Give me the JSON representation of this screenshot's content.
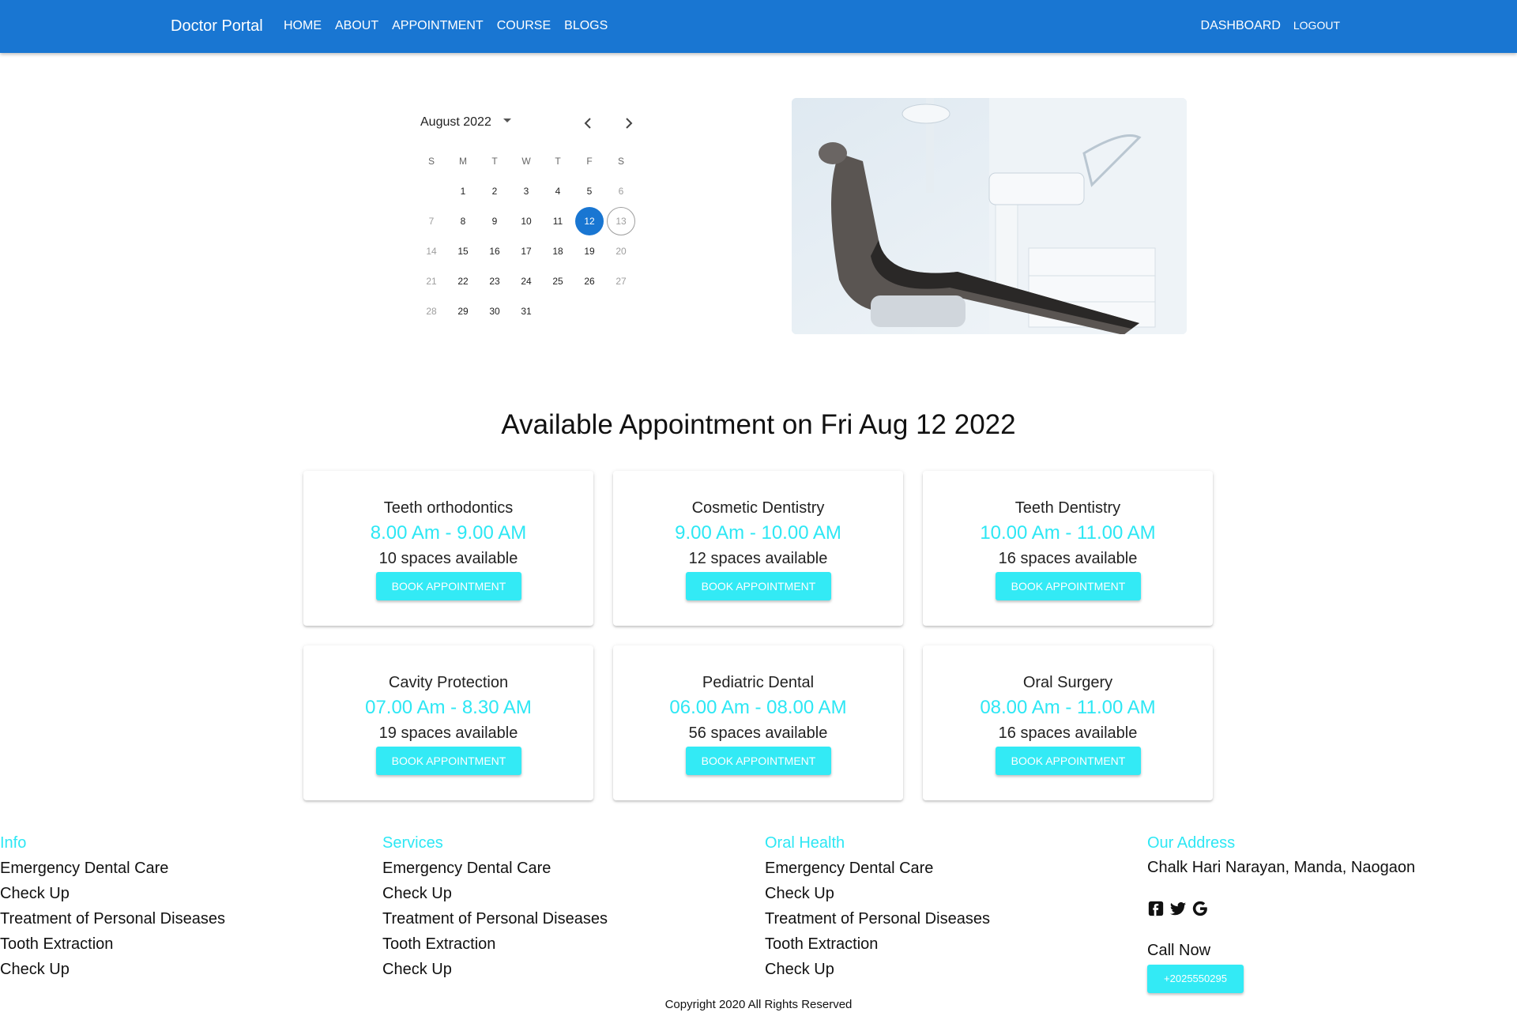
{
  "nav": {
    "brand": "Doctor Portal",
    "links": [
      "HOME",
      "ABOUT",
      "APPOINTMENT",
      "COURSE",
      "BLOGS"
    ],
    "dashboard": "DASHBOARD",
    "logout": "LOGOUT"
  },
  "calendar": {
    "month_label": "August 2022",
    "weekdays": [
      "S",
      "M",
      "T",
      "W",
      "T",
      "F",
      "S"
    ],
    "selected_day": 12,
    "today_day": 13,
    "leading_blanks": 1,
    "days": [
      {
        "d": "1",
        "muted": false
      },
      {
        "d": "2",
        "muted": false
      },
      {
        "d": "3",
        "muted": false
      },
      {
        "d": "4",
        "muted": false
      },
      {
        "d": "5",
        "muted": false
      },
      {
        "d": "6",
        "muted": true
      },
      {
        "d": "7",
        "muted": true
      },
      {
        "d": "8",
        "muted": false
      },
      {
        "d": "9",
        "muted": false
      },
      {
        "d": "10",
        "muted": false
      },
      {
        "d": "11",
        "muted": false
      },
      {
        "d": "12",
        "muted": false
      },
      {
        "d": "13",
        "muted": true
      },
      {
        "d": "14",
        "muted": true
      },
      {
        "d": "15",
        "muted": false
      },
      {
        "d": "16",
        "muted": false
      },
      {
        "d": "17",
        "muted": false
      },
      {
        "d": "18",
        "muted": false
      },
      {
        "d": "19",
        "muted": false
      },
      {
        "d": "20",
        "muted": true
      },
      {
        "d": "21",
        "muted": true
      },
      {
        "d": "22",
        "muted": false
      },
      {
        "d": "23",
        "muted": false
      },
      {
        "d": "24",
        "muted": false
      },
      {
        "d": "25",
        "muted": false
      },
      {
        "d": "26",
        "muted": false
      },
      {
        "d": "27",
        "muted": true
      },
      {
        "d": "28",
        "muted": true
      },
      {
        "d": "29",
        "muted": false
      },
      {
        "d": "30",
        "muted": false
      },
      {
        "d": "31",
        "muted": false
      }
    ]
  },
  "appointments": {
    "title": "Available Appointment on Fri Aug 12 2022",
    "book_label": "BOOK APPOINTMENT",
    "items": [
      {
        "service": "Teeth orthodontics",
        "time": "8.00 Am - 9.00 AM",
        "spaces": "10 spaces available"
      },
      {
        "service": "Cosmetic Dentistry",
        "time": "9.00 Am - 10.00 AM",
        "spaces": "12 spaces available"
      },
      {
        "service": "Teeth Dentistry",
        "time": "10.00 Am - 11.00 AM",
        "spaces": "16 spaces available"
      },
      {
        "service": "Cavity Protection",
        "time": "07.00 Am - 8.30 AM",
        "spaces": "19 spaces available"
      },
      {
        "service": "Pediatric Dental",
        "time": "06.00 Am - 08.00 AM",
        "spaces": "56 spaces available"
      },
      {
        "service": "Oral Surgery",
        "time": "08.00 Am - 11.00 AM",
        "spaces": "16 spaces available"
      }
    ]
  },
  "footer": {
    "columns": [
      {
        "heading": "Info",
        "items": [
          "Emergency Dental Care",
          "Check Up",
          "Treatment of Personal Diseases",
          "Tooth Extraction",
          "Check Up"
        ]
      },
      {
        "heading": "Services",
        "items": [
          "Emergency Dental Care",
          "Check Up",
          "Treatment of Personal Diseases",
          "Tooth Extraction",
          "Check Up"
        ]
      },
      {
        "heading": "Oral Health",
        "items": [
          "Emergency Dental Care",
          "Check Up",
          "Treatment of Personal Diseases",
          "Tooth Extraction",
          "Check Up"
        ]
      }
    ],
    "address_heading": "Our Address",
    "address": "Chalk Hari Narayan, Manda, Naogaon",
    "socials": [
      "facebook-icon",
      "twitter-icon",
      "google-icon"
    ],
    "call_label": "Call Now",
    "phone": "+2025550295",
    "copyright": "Copyright 2020 All Rights Reserved"
  },
  "colors": {
    "primary": "#1976d2",
    "accent": "#33eaf5",
    "time_text": "#2de7f4"
  }
}
